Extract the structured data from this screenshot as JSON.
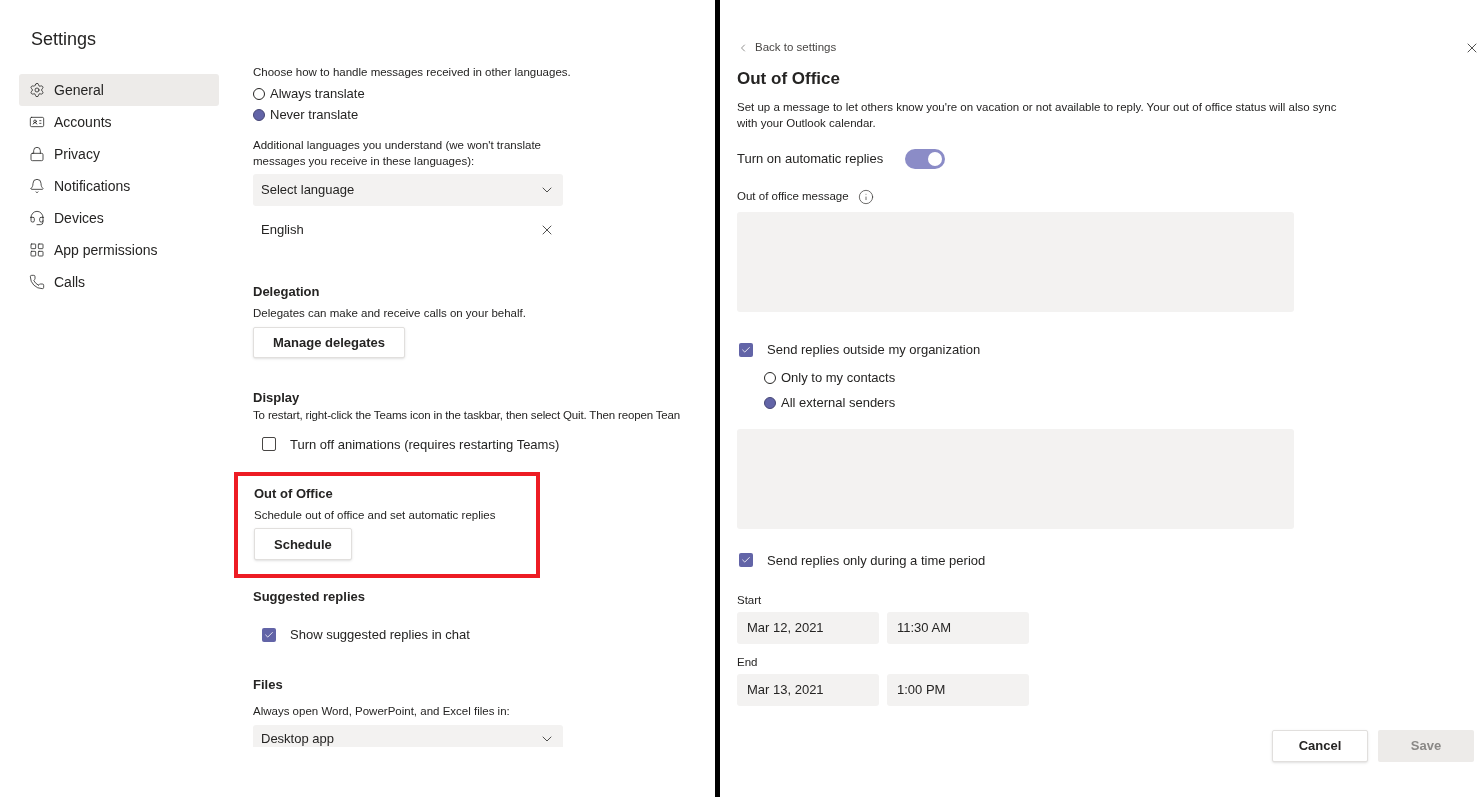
{
  "settings": {
    "title": "Settings",
    "nav": [
      {
        "label": "General",
        "selected": true
      },
      {
        "label": "Accounts",
        "selected": false
      },
      {
        "label": "Privacy",
        "selected": false
      },
      {
        "label": "Notifications",
        "selected": false
      },
      {
        "label": "Devices",
        "selected": false
      },
      {
        "label": "App permissions",
        "selected": false
      },
      {
        "label": "Calls",
        "selected": false
      }
    ]
  },
  "general": {
    "translation": {
      "prompt": "Choose how to handle messages received in other languages.",
      "options": [
        {
          "label": "Always translate",
          "selected": false
        },
        {
          "label": "Never translate",
          "selected": true
        }
      ]
    },
    "languages": {
      "prompt": "Additional languages you understand (we won't translate messages you receive in these languages):",
      "placeholder": "Select language",
      "items": [
        "English"
      ]
    },
    "delegation": {
      "heading": "Delegation",
      "description": "Delegates can make and receive calls on your behalf.",
      "button": "Manage delegates"
    },
    "display": {
      "heading": "Display",
      "description": "To restart, right-click the Teams icon in the taskbar, then select Quit. Then reopen Tean",
      "checkbox": {
        "label": "Turn off animations (requires restarting Teams)",
        "checked": false
      }
    },
    "out_of_office": {
      "heading": "Out of Office",
      "description": "Schedule out of office and set automatic replies",
      "button": "Schedule",
      "highlighted": true
    },
    "suggested_replies": {
      "heading": "Suggested replies",
      "checkbox": {
        "label": "Show suggested replies in chat",
        "checked": true
      }
    },
    "files": {
      "heading": "Files",
      "description": "Always open Word, PowerPoint, and Excel files in:",
      "value": "Desktop app"
    }
  },
  "out_of_office_panel": {
    "back_link": "Back to settings",
    "title": "Out of Office",
    "description": "Set up a message to let others know you're on vacation or not available to reply. Your out of office status will also sync with your Outlook calendar.",
    "toggle": {
      "label": "Turn on automatic replies",
      "on": true
    },
    "message_label": "Out of office message",
    "external": {
      "label": "Send replies outside my organization",
      "checked": true,
      "options": [
        {
          "label": "Only to my contacts",
          "selected": false
        },
        {
          "label": "All external senders",
          "selected": true
        }
      ]
    },
    "time_period": {
      "label": "Send replies only during a time period",
      "checked": true
    },
    "start": {
      "label": "Start",
      "date": "Mar 12, 2021",
      "time": "11:30 AM"
    },
    "end": {
      "label": "End",
      "date": "Mar 13, 2021",
      "time": "1:00 PM"
    },
    "cancel": "Cancel",
    "save": {
      "label": "Save",
      "disabled": true
    }
  }
}
